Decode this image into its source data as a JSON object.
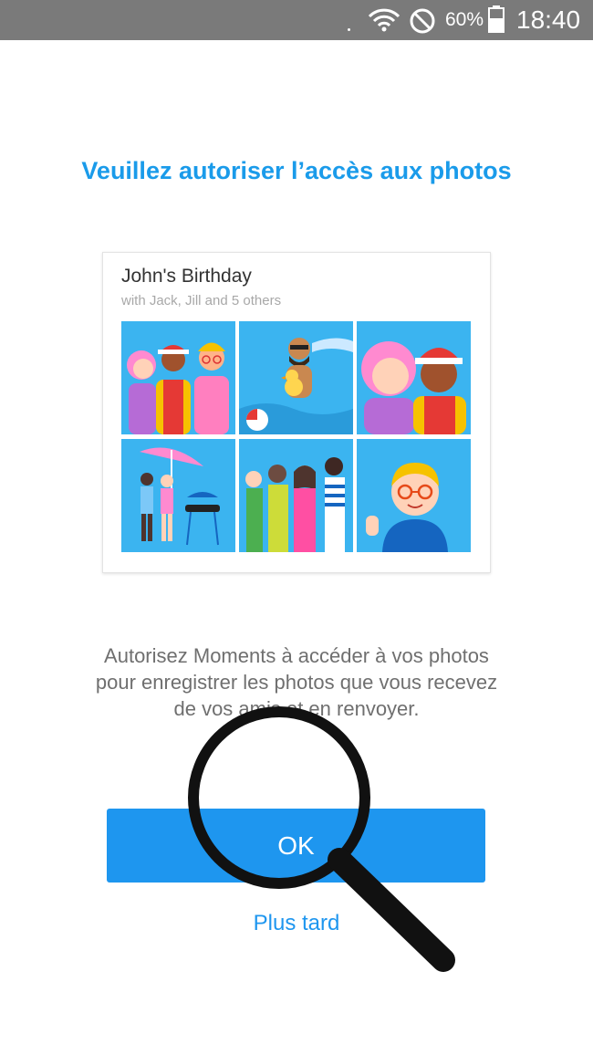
{
  "statusbar": {
    "battery_text": "60%",
    "time": "18:40",
    "icons": [
      "wifi-icon",
      "do-not-disturb-icon",
      "battery-icon"
    ]
  },
  "screen": {
    "title": "Veuillez autoriser l’accès aux photos",
    "description": "Autorisez Moments à accéder à vos photos pour enregistrer les photos que vous recevez de vos amis et en renvoyer.",
    "ok_label": "OK",
    "later_label": "Plus tard"
  },
  "card": {
    "title": "John's Birthday",
    "subtitle": "with Jack, Jill and 5 others",
    "photos": [
      "party-group-photo",
      "pool-float-photo",
      "couple-closeup-photo",
      "bbq-umbrella-photo",
      "friends-group-photo",
      "portrait-glasses-photo"
    ]
  },
  "colors": {
    "accent": "#1e96ef",
    "title": "#1a9bea",
    "statusbar": "#7a7a7a",
    "tile_bg": "#3bb4f0"
  }
}
